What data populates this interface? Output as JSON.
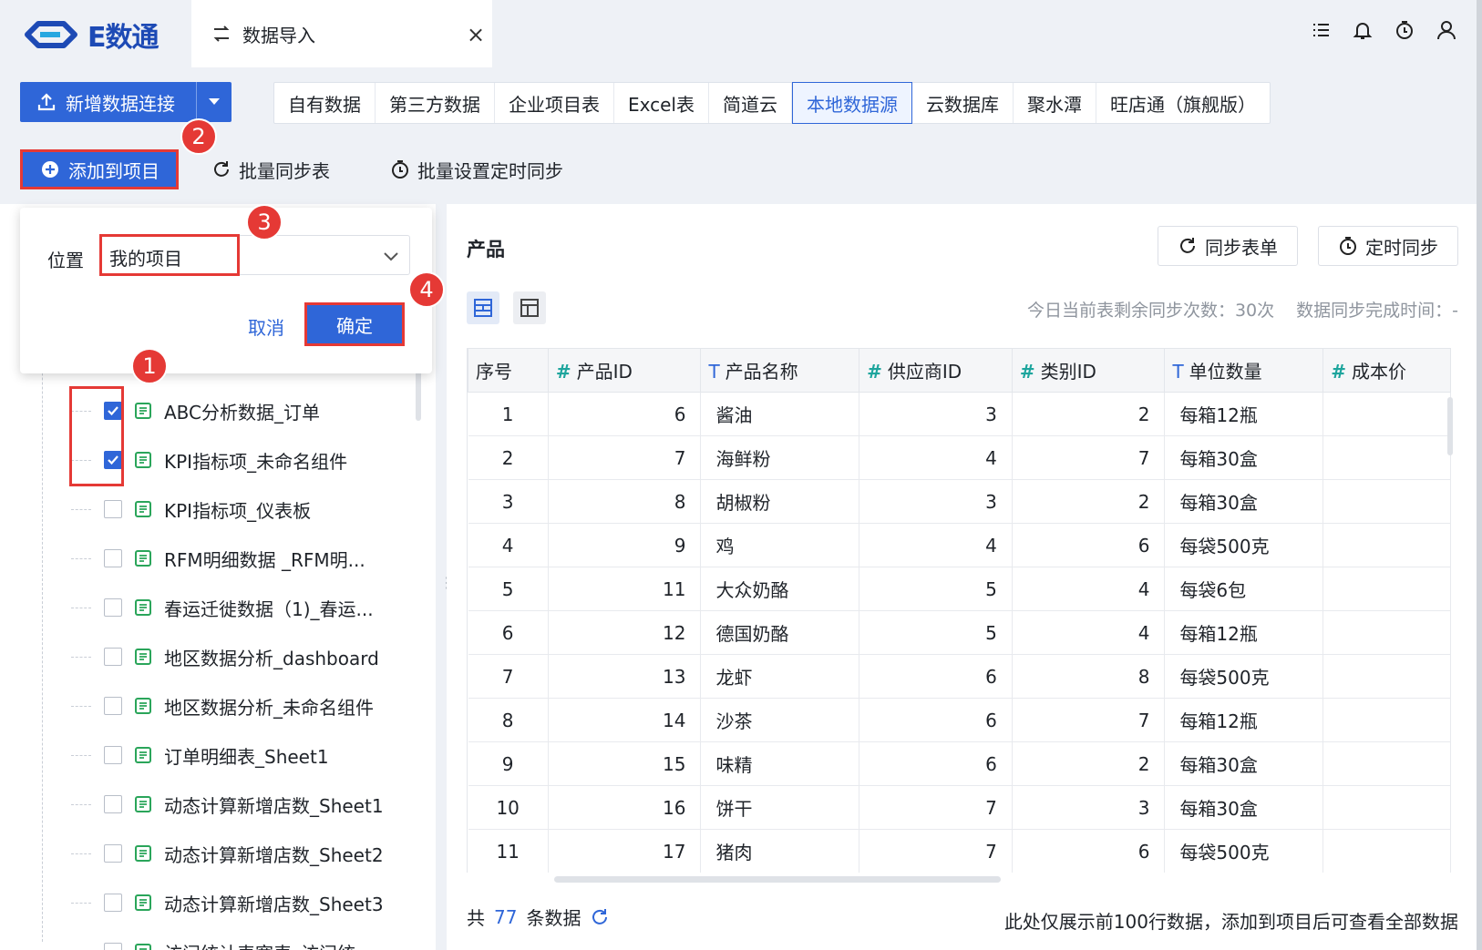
{
  "app": {
    "logo_text": "E数通",
    "tab_title": "数据导入",
    "tab_close": "×"
  },
  "toolbar": {
    "new_connection": "新增数据连接",
    "source_tabs": [
      "自有数据",
      "第三方数据",
      "企业项目表",
      "Excel表",
      "简道云",
      "本地数据源",
      "云数据库",
      "聚水潭",
      "旺店通（旗舰版）"
    ],
    "active_source": "本地数据源",
    "add_to_project": "添加到项目",
    "batch_sync": "批量同步表",
    "batch_timer": "批量设置定时同步"
  },
  "badges": {
    "b1": "1",
    "b2": "2",
    "b3": "3",
    "b4": "4"
  },
  "popup": {
    "position_label": "位置",
    "position_value": "我的项目",
    "cancel": "取消",
    "confirm": "确定"
  },
  "file_list": [
    {
      "name": "ABC分析数据_订单",
      "checked": true
    },
    {
      "name": "KPI指标项_未命名组件",
      "checked": true
    },
    {
      "name": "KPI指标项_仪表板",
      "checked": false
    },
    {
      "name": "RFM明细数据 _RFM明...",
      "checked": false
    },
    {
      "name": "春运迁徙数据（1)_春运...",
      "checked": false
    },
    {
      "name": "地区数据分析_dashboard",
      "checked": false
    },
    {
      "name": "地区数据分析_未命名组件",
      "checked": false
    },
    {
      "name": "订单明细表_Sheet1",
      "checked": false
    },
    {
      "name": "动态计算新增店数_Sheet1",
      "checked": false
    },
    {
      "name": "动态计算新增店数_Sheet2",
      "checked": false
    },
    {
      "name": "动态计算新增店数_Sheet3",
      "checked": false
    },
    {
      "name": "访问统计表宽表_访问统...",
      "checked": false
    }
  ],
  "detail": {
    "title": "产品",
    "sync_form": "同步表单",
    "timer_sync": "定时同步",
    "sync_remaining": "今日当前表剩余同步次数：30次",
    "sync_done_time": "数据同步完成时间：-"
  },
  "table": {
    "columns": [
      {
        "label": "序号",
        "type": ""
      },
      {
        "label": "产品ID",
        "type": "#"
      },
      {
        "label": "产品名称",
        "type": "T"
      },
      {
        "label": "供应商ID",
        "type": "#"
      },
      {
        "label": "类别ID",
        "type": "#"
      },
      {
        "label": "单位数量",
        "type": "T"
      },
      {
        "label": "成本价",
        "type": "#"
      }
    ],
    "rows": [
      [
        "1",
        "6",
        "酱油",
        "3",
        "2",
        "每箱12瓶",
        ""
      ],
      [
        "2",
        "7",
        "海鲜粉",
        "4",
        "7",
        "每箱30盒",
        ""
      ],
      [
        "3",
        "8",
        "胡椒粉",
        "3",
        "2",
        "每箱30盒",
        ""
      ],
      [
        "4",
        "9",
        "鸡",
        "4",
        "6",
        "每袋500克",
        ""
      ],
      [
        "5",
        "11",
        "大众奶酪",
        "5",
        "4",
        "每袋6包",
        ""
      ],
      [
        "6",
        "12",
        "德国奶酪",
        "5",
        "4",
        "每箱12瓶",
        ""
      ],
      [
        "7",
        "13",
        "龙虾",
        "6",
        "8",
        "每袋500克",
        ""
      ],
      [
        "8",
        "14",
        "沙茶",
        "6",
        "7",
        "每箱12瓶",
        ""
      ],
      [
        "9",
        "15",
        "味精",
        "6",
        "2",
        "每箱30盒",
        ""
      ],
      [
        "10",
        "16",
        "饼干",
        "7",
        "3",
        "每箱30盒",
        ""
      ],
      [
        "11",
        "17",
        "猪肉",
        "7",
        "6",
        "每袋500克",
        ""
      ]
    ]
  },
  "footer": {
    "prefix": "共",
    "count": "77",
    "suffix": "条数据",
    "note": "此处仅展示前100行数据，添加到项目后可查看全部数据"
  },
  "colors": {
    "accent": "#2f66d8",
    "highlight": "#e53935",
    "number_type": "#1da59d",
    "file_icon": "#2aa55a"
  }
}
